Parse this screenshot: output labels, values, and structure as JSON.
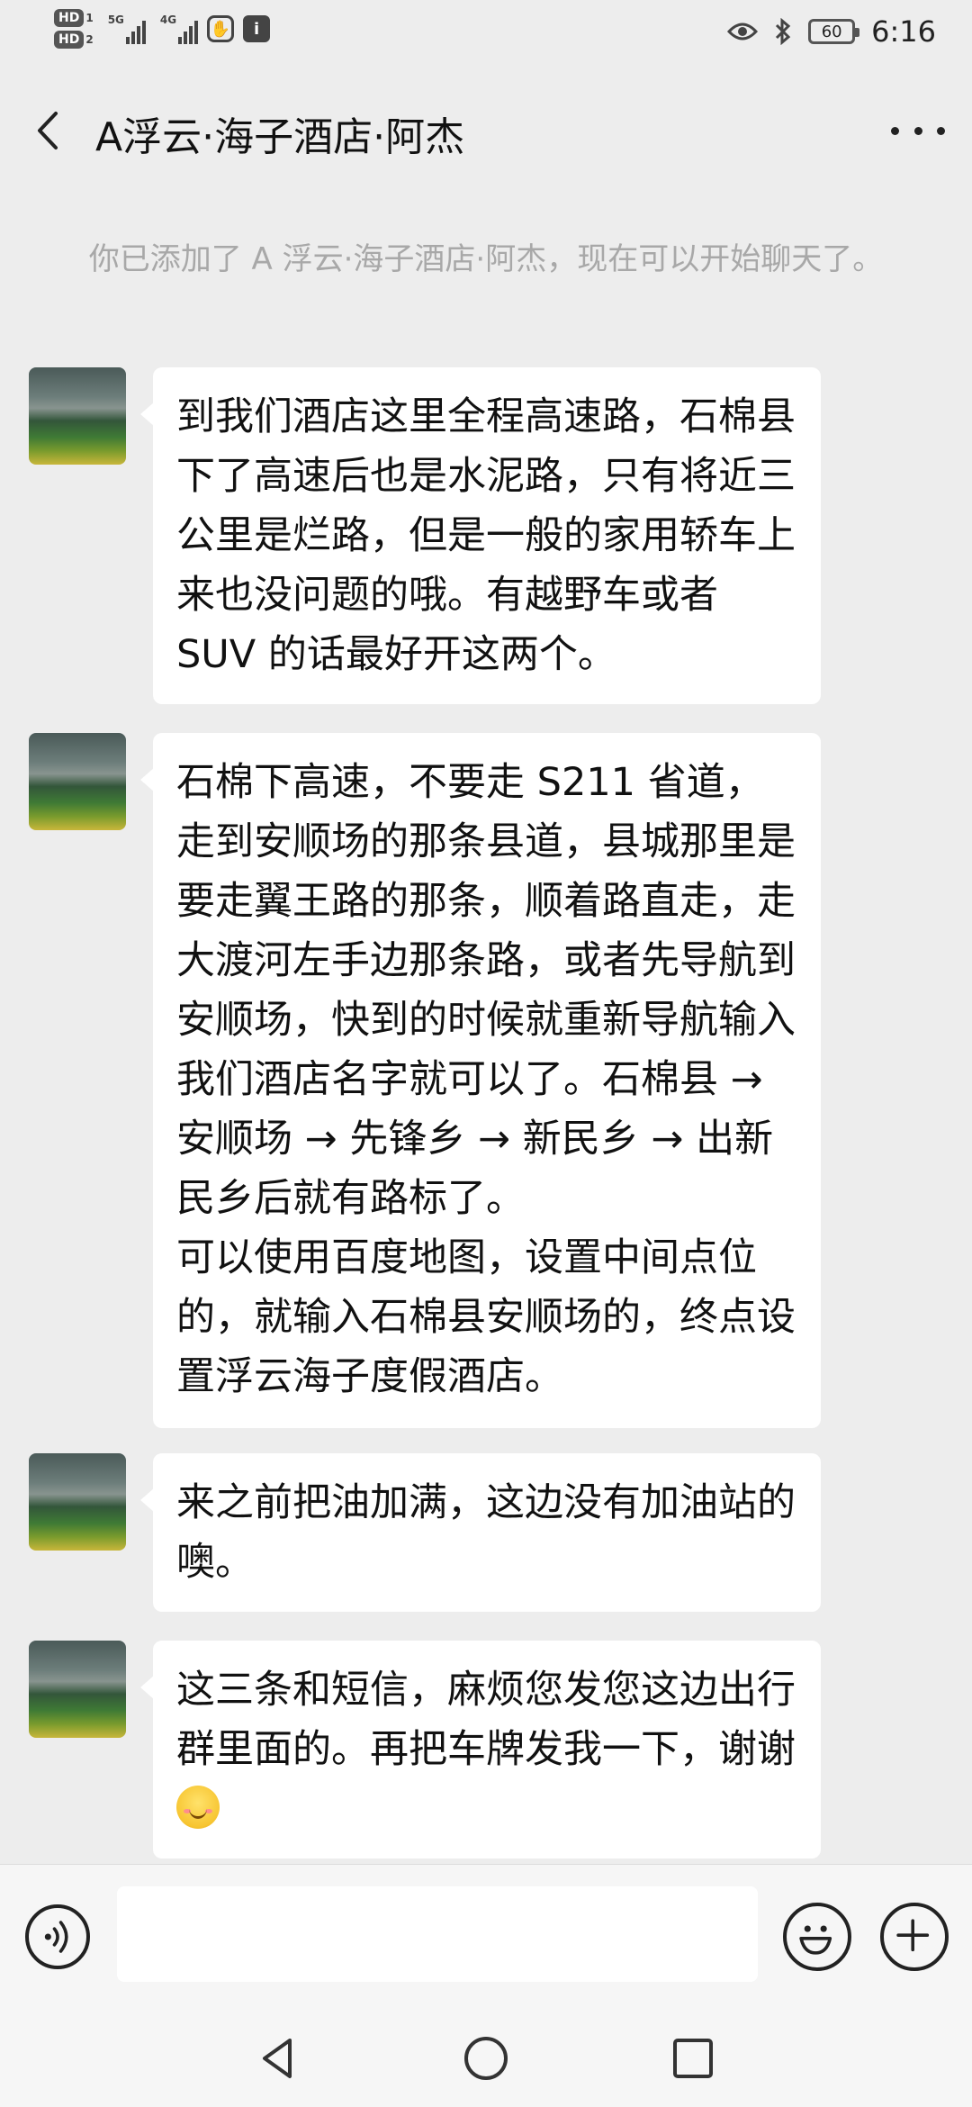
{
  "status_bar": {
    "hd1": "HD",
    "hd1_sub": "1",
    "hd2": "HD",
    "hd2_sub": "2",
    "net1": "5G",
    "net2": "4G",
    "battery": "60",
    "time": "6:16",
    "icons": [
      "eye-icon",
      "bluetooth-icon",
      "battery-icon"
    ]
  },
  "header": {
    "title": "A浮云·海子酒店·阿杰",
    "back_icon": "chevron-left-icon",
    "more_icon": "more-dots-icon"
  },
  "chat": {
    "system_notice": "你已添加了 A 浮云·海子酒店·阿杰，现在可以开始聊天了。",
    "messages": [
      {
        "sender": "contact",
        "text": "到我们酒店这里全程高速路，石棉县下了高速后也是水泥路，只有将近三公里是烂路，但是一般的家用轿车上来也没问题的哦。有越野车或者 SUV 的话最好开这两个。"
      },
      {
        "sender": "contact",
        "text": "石棉下高速，不要走 S211 省道，走到安顺场的那条县道，县城那里是要走翼王路的那条，顺着路直走，走大渡河左手边那条路，或者先导航到安顺场，快到的时候就重新导航输入我们酒店名字就可以了。石棉县 → 安顺场 → 先锋乡 → 新民乡 → 出新民乡后就有路标了。\n可以使用百度地图，设置中间点位的，就输入石棉县安顺场的，终点设置浮云海子度假酒店。"
      },
      {
        "sender": "contact",
        "text": "来之前把油加满，这边没有加油站的噢。"
      },
      {
        "sender": "contact",
        "text": "这三条和短信，麻烦您发您这边出行群里面的。再把车牌发我一下，谢谢",
        "emoji": "smile-emoji"
      }
    ]
  },
  "input_bar": {
    "value": "",
    "voice_icon": "voice-icon",
    "emoji_icon": "emoji-icon",
    "plus_icon": "plus-icon"
  },
  "nav_bar": {
    "icons": [
      "nav-back-icon",
      "nav-home-icon",
      "nav-recent-icon"
    ]
  }
}
